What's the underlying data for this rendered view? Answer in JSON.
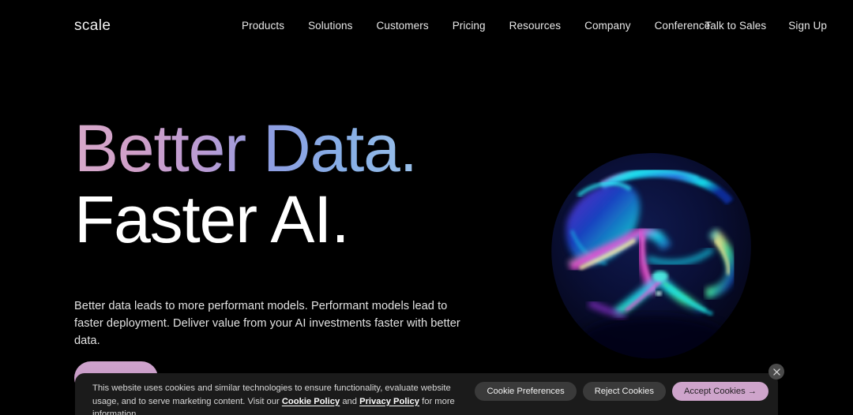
{
  "brand": {
    "logo_text": "scale"
  },
  "nav": {
    "links": [
      {
        "label": "Products"
      },
      {
        "label": "Solutions"
      },
      {
        "label": "Customers"
      },
      {
        "label": "Pricing"
      },
      {
        "label": "Resources"
      },
      {
        "label": "Company"
      },
      {
        "label": "Conference"
      }
    ],
    "actions": [
      {
        "label": "Talk to Sales"
      },
      {
        "label": "Sign Up"
      }
    ]
  },
  "hero": {
    "headline_line1": "Better Data.",
    "headline_line2": "Faster AI.",
    "subcopy": "Better data leads to more performant models. Performant models lead to faster deployment. Deliver value from your AI investments faster with better data.",
    "cta_label": "",
    "gradient_start": "#d7a9cb",
    "gradient_mid": "#8e9ee2",
    "gradient_end": "#aecfee",
    "accent": "#cea4cb"
  },
  "graphic": {
    "name": "iridescent-orb",
    "colors": [
      "#0a0f3c",
      "#16d0ea",
      "#ff3fd4",
      "#f2ef8a",
      "#38e08a",
      "#6a3fe0"
    ]
  },
  "cookie_banner": {
    "text_part1": "This website uses cookies and similar technologies to ensure functionality, evaluate website usage, and to serve marketing content. Visit our ",
    "link1": "Cookie Policy",
    "text_part2": " and ",
    "link2": "Privacy Policy",
    "text_part3": " for more information.",
    "buttons": [
      {
        "label": "Cookie Preferences",
        "style": "dark"
      },
      {
        "label": "Reject Cookies",
        "style": "dark"
      },
      {
        "label": "Accept Cookies →",
        "style": "accent"
      }
    ],
    "close_label": "×"
  }
}
